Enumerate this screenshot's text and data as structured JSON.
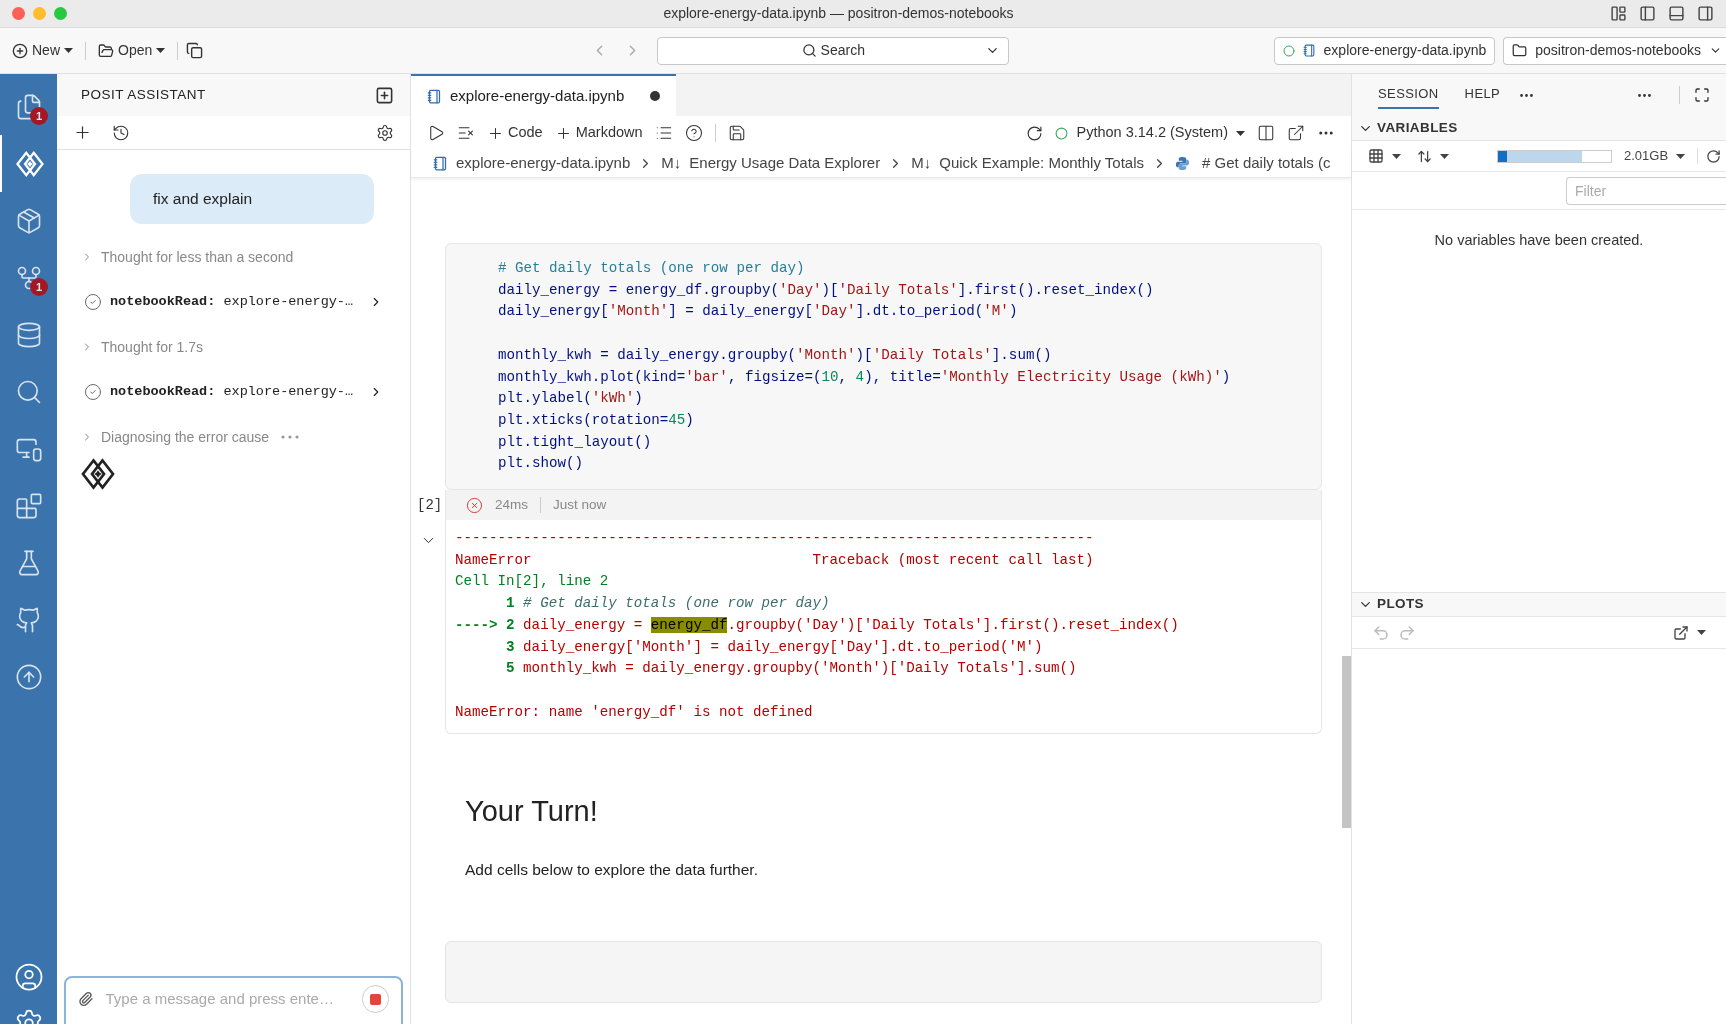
{
  "window": {
    "title": "explore-energy-data.ipynb — positron-demos-notebooks"
  },
  "toolbar": {
    "new_label": "New",
    "open_label": "Open",
    "search_label": "Search",
    "session_button": "explore-energy-data.ipynb",
    "folder_button": "positron-demos-notebooks"
  },
  "activity_bar": [
    {
      "selected": false,
      "badge": "1"
    },
    {
      "selected": true
    },
    {
      "selected": false
    },
    {
      "selected": false,
      "badge": "1"
    },
    {
      "selected": false
    },
    {
      "selected": false
    },
    {
      "selected": false
    },
    {
      "selected": false
    },
    {
      "selected": false
    },
    {
      "selected": false
    },
    {
      "selected": false
    }
  ],
  "assistant": {
    "title": "POSIT ASSISTANT",
    "input_placeholder": "Type a message and press ente…",
    "messages": [
      {
        "kind": "user",
        "text": "fix and explain"
      },
      {
        "kind": "thought",
        "text": "Thought for less than a second"
      },
      {
        "kind": "tool",
        "name": "notebookRead:",
        "arg": "explore-energy-…"
      },
      {
        "kind": "thought",
        "text": "Thought for 1.7s"
      },
      {
        "kind": "tool",
        "name": "notebookRead:",
        "arg": "explore-energy-…"
      },
      {
        "kind": "progress",
        "text": "Diagnosing the error cause"
      }
    ]
  },
  "editor": {
    "tab": {
      "label": "explore-energy-data.ipynb",
      "modified": true
    },
    "toolbar": {
      "code_label": "Code",
      "markdown_label": "Markdown",
      "kernel": "Python 3.14.2 (System)"
    },
    "breadcrumbs": [
      {
        "kind": "notebook",
        "label": "explore-energy-data.ipynb"
      },
      {
        "kind": "markdown",
        "glyph": "M↓",
        "label": "Energy Usage Data Explorer"
      },
      {
        "kind": "markdown",
        "glyph": "M↓",
        "label": "Quick Example: Monthly Totals"
      },
      {
        "kind": "python",
        "label": "# Get daily totals (c"
      }
    ],
    "code_cell": {
      "paragraphs": [
        [
          [
            {
              "kind": "comment",
              "text": "# Get daily totals (one row per day)"
            }
          ],
          [
            {
              "kind": "name",
              "text": "daily_energy = energy_df.groupby("
            },
            {
              "kind": "string",
              "text": "'Day'"
            },
            {
              "kind": "name",
              "text": ")["
            },
            {
              "kind": "string",
              "text": "'Daily Totals'"
            },
            {
              "kind": "name",
              "text": "].first().reset_index()"
            }
          ],
          [
            {
              "kind": "name",
              "text": "daily_energy["
            },
            {
              "kind": "string",
              "text": "'Month'"
            },
            {
              "kind": "name",
              "text": "] = daily_energy["
            },
            {
              "kind": "string",
              "text": "'Day'"
            },
            {
              "kind": "name",
              "text": "].dt.to_period("
            },
            {
              "kind": "string",
              "text": "'M'"
            },
            {
              "kind": "name",
              "text": ")"
            }
          ]
        ],
        [
          [
            {
              "kind": "name",
              "text": "monthly_kwh = daily_energy.groupby("
            },
            {
              "kind": "string",
              "text": "'Month'"
            },
            {
              "kind": "name",
              "text": ")["
            },
            {
              "kind": "string",
              "text": "'Daily Totals'"
            },
            {
              "kind": "name",
              "text": "].sum()"
            }
          ],
          [
            {
              "kind": "name",
              "text": "monthly_kwh.plot(kind="
            },
            {
              "kind": "string",
              "text": "'bar'"
            },
            {
              "kind": "name",
              "text": ", figsize=("
            },
            {
              "kind": "number",
              "text": "10"
            },
            {
              "kind": "name",
              "text": ", "
            },
            {
              "kind": "number",
              "text": "4"
            },
            {
              "kind": "name",
              "text": "), title="
            },
            {
              "kind": "string",
              "text": "'Monthly Electricity Usage (kWh)'"
            },
            {
              "kind": "name",
              "text": ")"
            }
          ],
          [
            {
              "kind": "name",
              "text": "plt.ylabel("
            },
            {
              "kind": "string",
              "text": "'kWh'"
            },
            {
              "kind": "name",
              "text": ")"
            }
          ],
          [
            {
              "kind": "name",
              "text": "plt.xticks(rotation="
            },
            {
              "kind": "number",
              "text": "45"
            },
            {
              "kind": "name",
              "text": ")"
            }
          ],
          [
            {
              "kind": "name",
              "text": "plt.tight_layout()"
            }
          ],
          [
            {
              "kind": "name",
              "text": "plt.show()"
            }
          ]
        ]
      ],
      "execution_count": "[2]",
      "failed": true,
      "duration": "24ms",
      "when": "Just now",
      "output": [
        [
          [
            {
              "kind": "error",
              "text": "---------------------------------------------------------------------------"
            }
          ],
          [
            {
              "kind": "error",
              "text": "NameError                                 Traceback (most recent call last)"
            }
          ],
          [
            {
              "kind": "location",
              "text": "Cell In[2], line 2"
            }
          ],
          [
            {
              "kind": "lineno",
              "text": "1"
            },
            {
              "kind": "comment",
              "text": "# Get daily totals (one row per day)"
            }
          ],
          [
            {
              "kind": "lineno",
              "text": "----> 2"
            },
            {
              "kind": "error",
              "text": "daily_energy = "
            },
            {
              "kind": "highlight",
              "text": "energy_df"
            },
            {
              "kind": "error",
              "text": ".groupby('Day')['Daily Totals'].first().reset_index()"
            }
          ],
          [
            {
              "kind": "lineno",
              "text": "3"
            },
            {
              "kind": "error",
              "text": "daily_energy['Month'] = daily_energy['Day'].dt.to_period('M')"
            }
          ],
          [
            {
              "kind": "lineno",
              "text": "5"
            },
            {
              "kind": "error",
              "text": "monthly_kwh = daily_energy.groupby('Month')['Daily Totals'].sum()"
            }
          ]
        ],
        [
          [
            {
              "kind": "error",
              "text": "NameError: name 'energy_df' is not defined"
            }
          ]
        ]
      ]
    },
    "markdown_cell": {
      "heading": "Your Turn!",
      "paragraph": "Add cells below to explore the data further."
    }
  },
  "session_panel": {
    "tabs": [
      {
        "label": "SESSION",
        "selected": true
      },
      {
        "label": "HELP",
        "selected": false
      }
    ],
    "variables": {
      "title": "VARIABLES",
      "expanded": true,
      "memory": {
        "reading": "2.01GB",
        "segments": [
          {
            "level": 0.74,
            "color": "#bcd6ee"
          },
          {
            "level": 0.08,
            "color": "#1170c4"
          }
        ]
      },
      "filter_placeholder": "Filter",
      "empty_message": "No variables have been created."
    },
    "plots": {
      "title": "PLOTS",
      "expanded": true
    }
  }
}
